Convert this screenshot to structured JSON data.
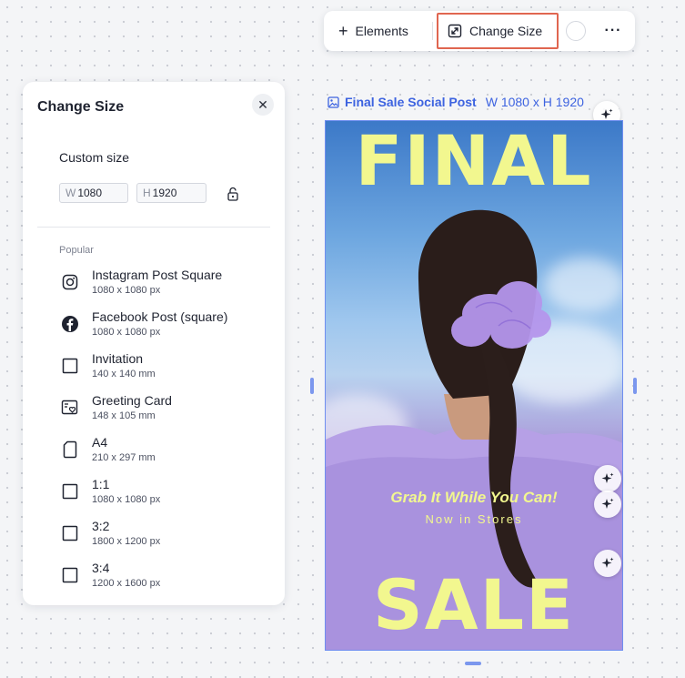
{
  "toolbar": {
    "elements_label": "Elements",
    "change_size_label": "Change Size",
    "more_label": "···"
  },
  "panel": {
    "title": "Change Size",
    "custom_size_label": "Custom size",
    "width_prefix": "W",
    "width_value": "1080",
    "height_prefix": "H",
    "height_value": "1920",
    "popular_label": "Popular",
    "items": [
      {
        "name": "Instagram Post Square",
        "size": "1080 x 1080 px",
        "icon": "instagram-icon"
      },
      {
        "name": "Facebook Post (square)",
        "size": "1080 x 1080 px",
        "icon": "facebook-icon"
      },
      {
        "name": "Invitation",
        "size": "140 x 140 mm",
        "icon": "square-icon"
      },
      {
        "name": "Greeting Card",
        "size": "148 x 105 mm",
        "icon": "greeting-card-icon"
      },
      {
        "name": "A4",
        "size": "210 x 297 mm",
        "icon": "document-icon"
      },
      {
        "name": "1:1",
        "size": "1080 x 1080 px",
        "icon": "square-icon"
      },
      {
        "name": "3:2",
        "size": "1800 x 1200 px",
        "icon": "square-icon"
      },
      {
        "name": "3:4",
        "size": "1200 x 1600 px",
        "icon": "square-icon"
      }
    ]
  },
  "canvas": {
    "design_name": "Final Sale Social Post",
    "design_size": "W 1080 x H 1920",
    "headline_top": "FINAL",
    "headline_bottom": "SALE",
    "tagline": "Grab It While You Can!",
    "subtagline": "Now in Stores"
  },
  "colors": {
    "accent": "#3d63e0",
    "highlight": "#e06650",
    "headline": "#f2f78f"
  }
}
